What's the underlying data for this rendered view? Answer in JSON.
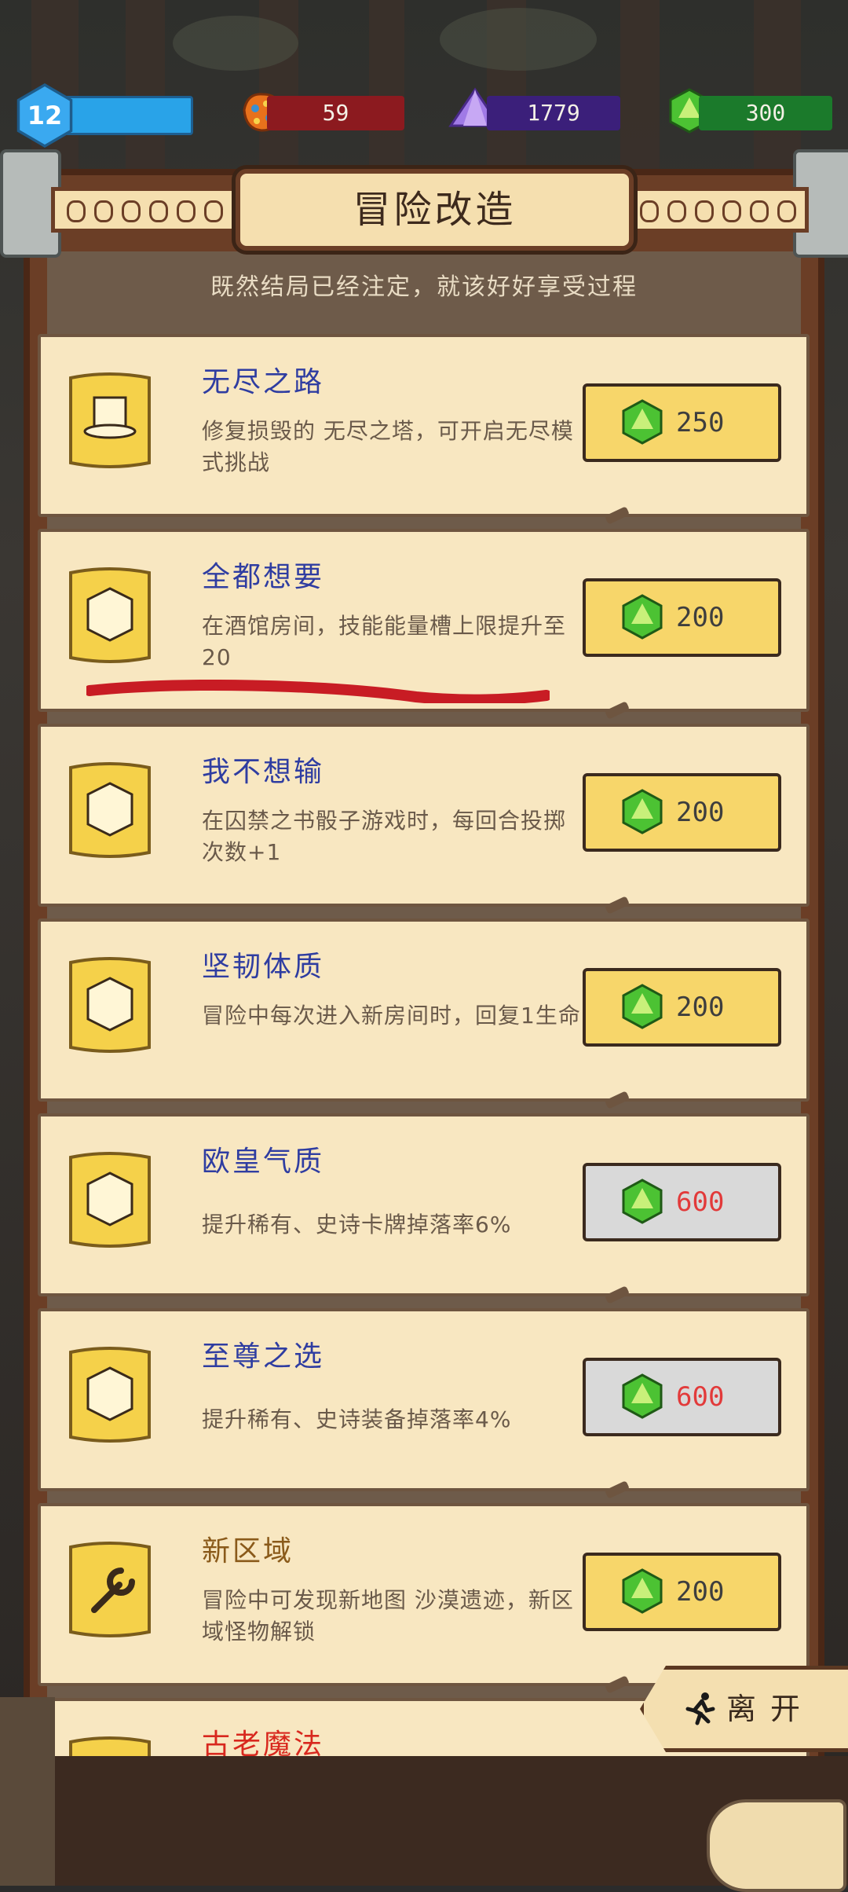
{
  "colors": {
    "accent_blue": "#29a3e8",
    "candy_red": "#8c1a1f",
    "prism_purple": "#3b1f7a",
    "gem_green": "#1b7a2b",
    "card_bg": "#f8e7c1",
    "button_yellow": "#f7d66a",
    "button_gray": "#d9d9d9",
    "title_blue": "#2f3da1",
    "underline_red": "#c81c24"
  },
  "currencies": {
    "level": "12",
    "level_progress": 0.94,
    "candy": "59",
    "prism": "1779",
    "gems": "300",
    "candy_icon": "candy-icon",
    "prism_icon": "prism-icon",
    "gem_icon": "gem-icon"
  },
  "header": {
    "title": "冒险改造",
    "subtitle": "既然结局已经注定，就该好好享受过程"
  },
  "upgrades": [
    {
      "title": "无尽之路",
      "description": "修复损毁的 无尽之塔，可开启无尽模式挑战",
      "price": "250",
      "available": true,
      "icon": "hat-scroll-icon"
    },
    {
      "title": "全都想要",
      "description": "在酒馆房间，技能能量槽上限提升至20",
      "price": "200",
      "available": true,
      "icon": "dice-scroll-icon"
    },
    {
      "title": "我不想输",
      "description": "在囚禁之书骰子游戏时，每回合投掷次数+1",
      "price": "200",
      "available": true,
      "icon": "dice-scroll-icon"
    },
    {
      "title": "坚韧体质",
      "description": "冒险中每次进入新房间时，回复1生命",
      "price": "200",
      "available": true,
      "icon": "dice-scroll-icon"
    },
    {
      "title": "欧皇气质",
      "description": "提升稀有、史诗卡牌掉落率6%",
      "price": "600",
      "available": false,
      "icon": "dice-scroll-icon"
    },
    {
      "title": "至尊之选",
      "description": "提升稀有、史诗装备掉落率4%",
      "price": "600",
      "available": false,
      "icon": "dice-scroll-icon"
    },
    {
      "title": "新区域",
      "description": "冒险中可发现新地图 沙漠遗迹，新区域怪物解锁",
      "price": "200",
      "available": true,
      "icon": "wrench-scroll-icon"
    },
    {
      "title": "古老魔法",
      "description": "",
      "price": "",
      "available": true,
      "icon": "scroll-icon"
    }
  ],
  "leave_button": {
    "label": "离开",
    "icon": "running-man-icon"
  }
}
